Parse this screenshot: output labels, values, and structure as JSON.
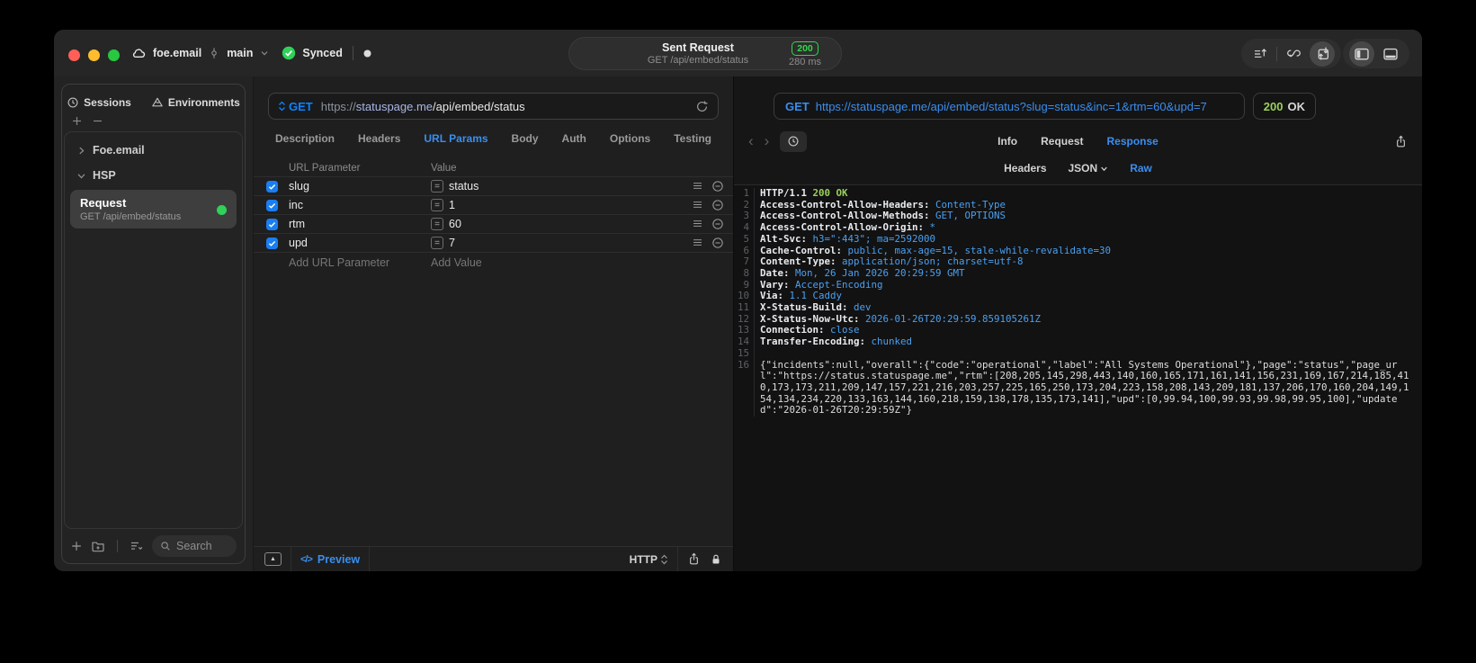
{
  "titlebar": {
    "project": "foe.email",
    "branch": "main",
    "sync": "Synced",
    "request_title": "Sent Request",
    "request_subtitle": "GET /api/embed/status",
    "status_code": "200",
    "duration": "280 ms"
  },
  "sidebar": {
    "tabs": [
      {
        "label": "Sessions"
      },
      {
        "label": "Environments"
      }
    ],
    "tree": [
      {
        "label": "Foe.email",
        "expanded": false
      },
      {
        "label": "HSP",
        "expanded": true
      }
    ],
    "request_item": {
      "title": "Request",
      "subtitle": "GET /api/embed/status"
    },
    "search_placeholder": "Search"
  },
  "editor": {
    "method": "GET",
    "url_scheme": "https://",
    "url_host": "statuspage.me",
    "url_path": "/api/embed/status",
    "tabs": [
      "Description",
      "Headers",
      "URL Params",
      "Body",
      "Auth",
      "Options",
      "Testing"
    ],
    "active_tab": "URL Params",
    "params": {
      "col_name": "URL Parameter",
      "col_value": "Value",
      "equals": "=",
      "rows": [
        {
          "enabled": true,
          "name": "slug",
          "value": "status"
        },
        {
          "enabled": true,
          "name": "inc",
          "value": "1"
        },
        {
          "enabled": true,
          "name": "rtm",
          "value": "60"
        },
        {
          "enabled": true,
          "name": "upd",
          "value": "7"
        }
      ],
      "add_name": "Add URL Parameter",
      "add_value": "Add Value"
    },
    "footer": {
      "code_glyph": "</>",
      "preview": "Preview",
      "protocol": "HTTP"
    }
  },
  "response": {
    "request_line_method": "GET",
    "request_line_url": "https://statuspage.me/api/embed/status?slug=status&inc=1&rtm=60&upd=7",
    "status_code": "200",
    "status_text": "OK",
    "tabs": [
      "Info",
      "Request",
      "Response"
    ],
    "active_tab": "Response",
    "subtabs": [
      "Headers",
      "JSON",
      "Raw"
    ],
    "active_subtab": "Raw",
    "lines": [
      {
        "n": "1",
        "segs": [
          [
            "h",
            "HTTP/1.1 "
          ],
          [
            "g",
            "200 OK"
          ]
        ]
      },
      {
        "n": "2",
        "segs": [
          [
            "h",
            "Access-Control-Allow-Headers: "
          ],
          [
            "v",
            "Content-Type"
          ]
        ]
      },
      {
        "n": "3",
        "segs": [
          [
            "h",
            "Access-Control-Allow-Methods: "
          ],
          [
            "v",
            "GET, OPTIONS"
          ]
        ]
      },
      {
        "n": "4",
        "segs": [
          [
            "h",
            "Access-Control-Allow-Origin: "
          ],
          [
            "v",
            "*"
          ]
        ]
      },
      {
        "n": "5",
        "segs": [
          [
            "h",
            "Alt-Svc: "
          ],
          [
            "v",
            "h3=\":443\"; ma=2592000"
          ]
        ]
      },
      {
        "n": "6",
        "segs": [
          [
            "h",
            "Cache-Control: "
          ],
          [
            "v",
            "public, max-age=15, stale-while-revalidate=30"
          ]
        ]
      },
      {
        "n": "7",
        "segs": [
          [
            "h",
            "Content-Type: "
          ],
          [
            "v",
            "application/json; charset=utf-8"
          ]
        ]
      },
      {
        "n": "8",
        "segs": [
          [
            "h",
            "Date: "
          ],
          [
            "v",
            "Mon, 26 Jan 2026 20:29:59 GMT"
          ]
        ]
      },
      {
        "n": "9",
        "segs": [
          [
            "h",
            "Vary: "
          ],
          [
            "v",
            "Accept-Encoding"
          ]
        ]
      },
      {
        "n": "10",
        "segs": [
          [
            "h",
            "Via: "
          ],
          [
            "v",
            "1.1 Caddy"
          ]
        ]
      },
      {
        "n": "11",
        "segs": [
          [
            "h",
            "X-Status-Build: "
          ],
          [
            "v",
            "dev"
          ]
        ]
      },
      {
        "n": "12",
        "segs": [
          [
            "h",
            "X-Status-Now-Utc: "
          ],
          [
            "v",
            "2026-01-26T20:29:59.859105261Z"
          ]
        ]
      },
      {
        "n": "13",
        "segs": [
          [
            "h",
            "Connection: "
          ],
          [
            "v",
            "close"
          ]
        ]
      },
      {
        "n": "14",
        "segs": [
          [
            "h",
            "Transfer-Encoding: "
          ],
          [
            "v",
            "chunked"
          ]
        ]
      },
      {
        "n": "15",
        "segs": []
      },
      {
        "n": "16",
        "segs": [
          [
            "j",
            "{\"incidents\":null,\"overall\":{\"code\":\"operational\",\"label\":\"All Systems Operational\"},\"page\":\"status\",\"page_url\":\"https://status.statuspage.me\",\"rtm\":[208,205,145,298,443,140,160,165,171,161,141,156,231,169,167,214,185,410,173,173,211,209,147,157,221,216,203,257,225,165,250,173,204,223,158,208,143,209,181,137,206,170,160,204,149,154,134,234,220,133,163,144,160,218,159,138,178,135,173,141],\"upd\":[0,99.94,100,99.93,99.98,99.95,100],\"updated\":\"2026-01-26T20:29:59Z\"}"
          ]
        ]
      }
    ]
  },
  "colors": {
    "accent": "#0a84ff",
    "green": "#30d158",
    "value_blue": "#4aa0f0",
    "response_green": "#9bd05a"
  }
}
